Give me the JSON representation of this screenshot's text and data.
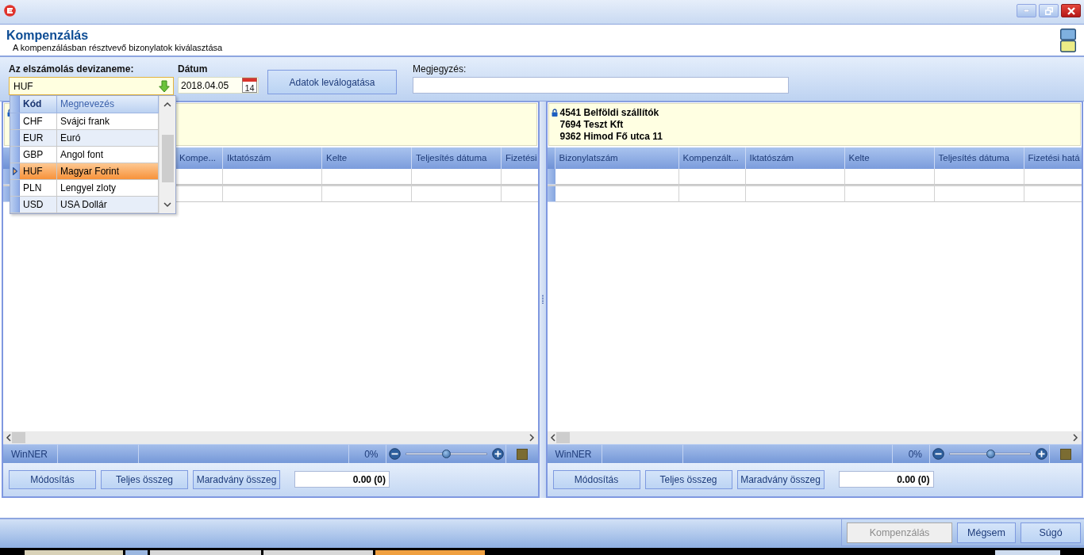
{
  "header": {
    "title": "Kompenzálás",
    "subtitle": "A kompenzálásban résztvevő bizonylatok kiválasztása"
  },
  "filters": {
    "currency": {
      "label": "Az elszámolás devizaneme:",
      "value": "HUF",
      "open": true
    },
    "date": {
      "label": "Dátum",
      "value": "2018.04.05",
      "calendar_day": "14"
    },
    "filter_button": "Adatok leválogatása",
    "note": {
      "label": "Megjegyzés:"
    }
  },
  "currency_dropdown": {
    "columns": [
      {
        "label": "Kód",
        "sorted": true
      },
      {
        "label": "Megnevezés",
        "sorted": false
      }
    ],
    "rows": [
      {
        "code": "CHF",
        "name": "Svájci frank",
        "selected": false
      },
      {
        "code": "EUR",
        "name": "Euró",
        "selected": false
      },
      {
        "code": "GBP",
        "name": "Angol font",
        "selected": false
      },
      {
        "code": "HUF",
        "name": "Magyar Forint",
        "selected": true
      },
      {
        "code": "PLN",
        "name": "Lengyel zloty",
        "selected": false
      },
      {
        "code": "USD",
        "name": "USA Dollár",
        "selected": false
      }
    ]
  },
  "panels": [
    {
      "columns": [
        "Kompe...",
        "Iktatószám",
        "Kelte",
        "Teljesítés dátuma",
        "Fizetési"
      ],
      "status_bar": {
        "app": "WinNER",
        "zoom": {
          "reading": "0%",
          "level": 0.5
        }
      },
      "buttons": [
        "Módosítás",
        "Teljes összeg",
        "Maradvány összeg"
      ],
      "total": "0.00 (0)"
    },
    {
      "info_lines": [
        "4541 Belföldi szállítók",
        "7694 Teszt Kft",
        "9362 Himod Fő utca 11"
      ],
      "columns": [
        "Bizonylatszám",
        "Kompenzált...",
        "Iktatószám",
        "Kelte",
        "Teljesítés dátuma",
        "Fizetési hatá"
      ],
      "status_bar": {
        "app": "WinNER",
        "zoom": {
          "reading": "0%",
          "level": 0.5
        }
      },
      "buttons": [
        "Módosítás",
        "Teljes összeg",
        "Maradvány összeg"
      ],
      "total": "0.00 (0)"
    }
  ],
  "footer": {
    "buttons": [
      {
        "label": "Kompenzálás",
        "disabled": true
      },
      {
        "label": "Mégsem",
        "disabled": false
      },
      {
        "label": "Súgó",
        "disabled": false
      }
    ]
  }
}
